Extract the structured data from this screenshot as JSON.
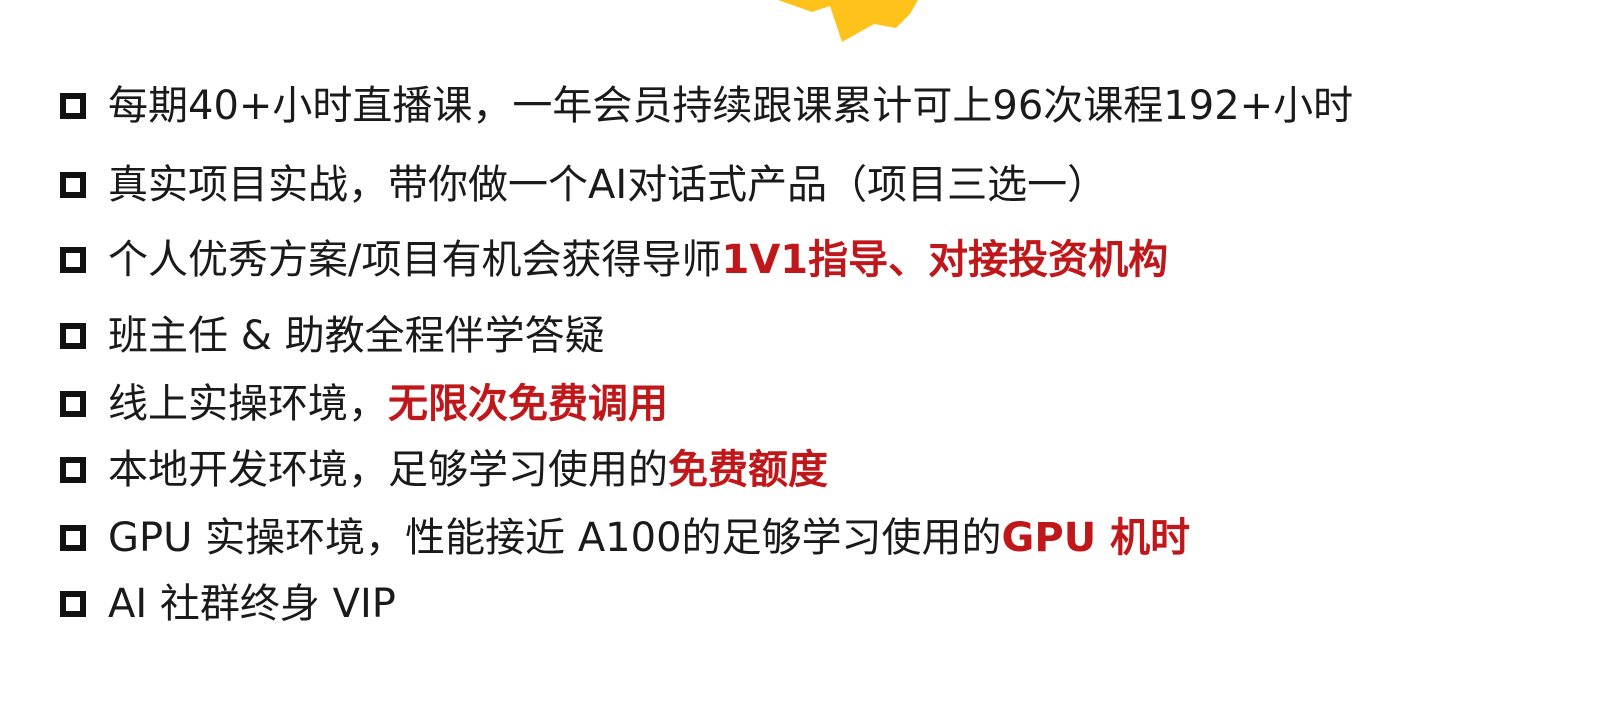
{
  "colors": {
    "background": "#ffffff",
    "text": "#1a1a1a",
    "highlight": "#c0171a",
    "starburst": "#ffc21a"
  },
  "decoration": {
    "top_icon": "starburst-icon"
  },
  "benefits": [
    {
      "icon": "checkbox-icon",
      "segments": [
        {
          "text": "每期40+小时直播课，一年会员持续跟课累计可上96次课程192+小时",
          "highlight": false
        }
      ]
    },
    {
      "icon": "checkbox-icon",
      "segments": [
        {
          "text": "真实项目实战，带你做一个AI对话式产品（项目三选一）",
          "highlight": false
        }
      ]
    },
    {
      "icon": "checkbox-icon",
      "segments": [
        {
          "text": "个人优秀方案/项目有机会获得导师",
          "highlight": false
        },
        {
          "text": "1V1指导、对接投资机构",
          "highlight": true
        }
      ]
    },
    {
      "icon": "checkbox-icon",
      "segments": [
        {
          "text": "班主任 & 助教全程伴学答疑",
          "highlight": false
        }
      ]
    },
    {
      "icon": "checkbox-icon",
      "segments": [
        {
          "text": "线上实操环境，",
          "highlight": false
        },
        {
          "text": "无限次免费调用",
          "highlight": true
        }
      ]
    },
    {
      "icon": "checkbox-icon",
      "segments": [
        {
          "text": "本地开发环境，足够学习使用的",
          "highlight": false
        },
        {
          "text": "免费额度",
          "highlight": true
        }
      ]
    },
    {
      "icon": "checkbox-icon",
      "segments": [
        {
          "text": "GPU 实操环境，性能接近 A100的足够学习使用的 ",
          "highlight": false
        },
        {
          "text": "GPU 机时",
          "highlight": true
        }
      ]
    },
    {
      "icon": "checkbox-icon",
      "segments": [
        {
          "text": "AI 社群终身 VIP",
          "highlight": false
        }
      ]
    }
  ]
}
